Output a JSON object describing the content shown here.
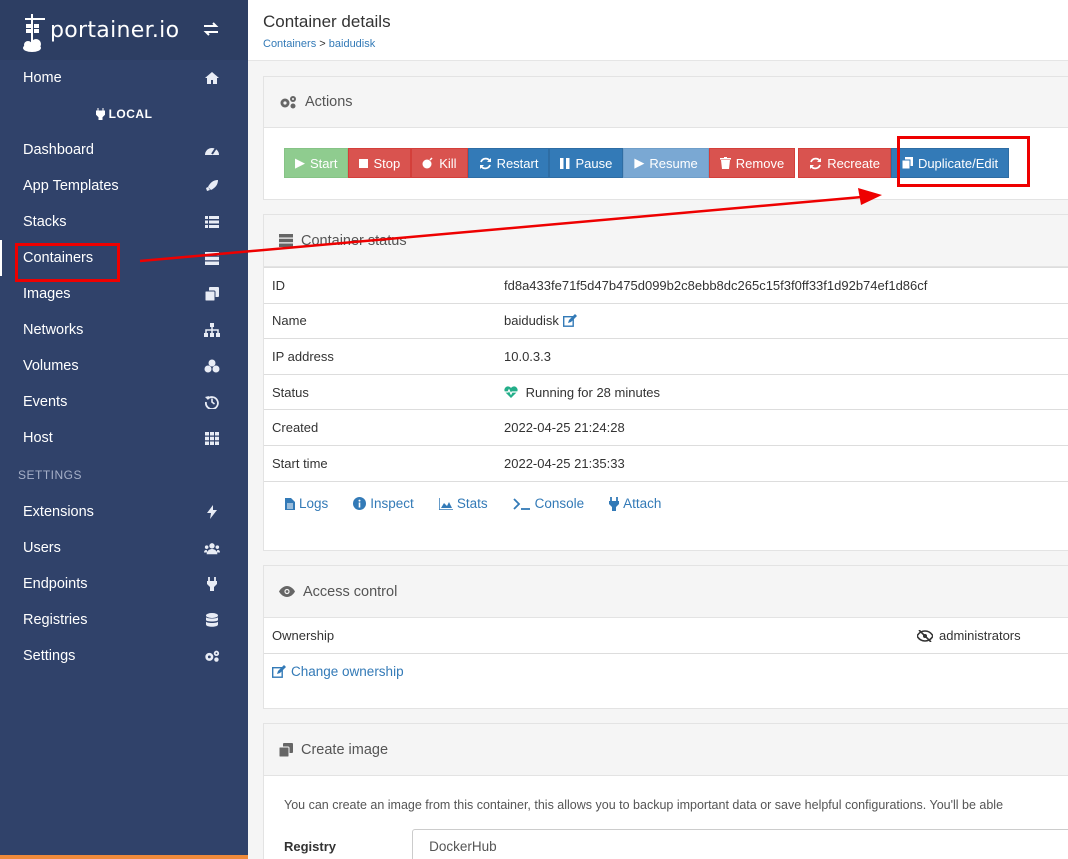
{
  "app": {
    "logo_text": "portainer.io"
  },
  "sidebar": {
    "home": "Home",
    "endpoint": "LOCAL",
    "items": [
      {
        "label": "Dashboard",
        "icon": "tachometer-icon"
      },
      {
        "label": "App Templates",
        "icon": "rocket-icon"
      },
      {
        "label": "Stacks",
        "icon": "list-icon"
      },
      {
        "label": "Containers",
        "icon": "server-icon"
      },
      {
        "label": "Images",
        "icon": "clone-icon"
      },
      {
        "label": "Networks",
        "icon": "sitemap-icon"
      },
      {
        "label": "Volumes",
        "icon": "cubes-icon"
      },
      {
        "label": "Events",
        "icon": "history-icon"
      },
      {
        "label": "Host",
        "icon": "th-icon"
      }
    ],
    "settings_title": "SETTINGS",
    "settings_items": [
      {
        "label": "Extensions",
        "icon": "bolt-icon"
      },
      {
        "label": "Users",
        "icon": "users-icon"
      },
      {
        "label": "Endpoints",
        "icon": "plug-icon"
      },
      {
        "label": "Registries",
        "icon": "database-icon"
      },
      {
        "label": "Settings",
        "icon": "cogs-icon"
      }
    ]
  },
  "header": {
    "title": "Container details",
    "breadcrumb_root": "Containers",
    "breadcrumb_sep": ">",
    "breadcrumb_current": "baidudisk"
  },
  "actions": {
    "title": "Actions",
    "start": "Start",
    "stop": "Stop",
    "kill": "Kill",
    "restart": "Restart",
    "pause": "Pause",
    "resume": "Resume",
    "remove": "Remove",
    "recreate": "Recreate",
    "duplicate": "Duplicate/Edit"
  },
  "status": {
    "title": "Container status",
    "rows": {
      "id_label": "ID",
      "id_value": "fd8a433fe71f5d47b475d099b2c8ebb8dc265c15f3f0ff33f1d92b74ef1d86cf",
      "name_label": "Name",
      "name_value": "baidudisk",
      "ip_label": "IP address",
      "ip_value": "10.0.3.3",
      "status_label": "Status",
      "status_value": "Running for 28 minutes",
      "created_label": "Created",
      "created_value": "2022-04-25 21:24:28",
      "start_label": "Start time",
      "start_value": "2022-04-25 21:35:33"
    },
    "links": {
      "logs": "Logs",
      "inspect": "Inspect",
      "stats": "Stats",
      "console": "Console",
      "attach": "Attach"
    }
  },
  "access": {
    "title": "Access control",
    "ownership_label": "Ownership",
    "ownership_value": "administrators",
    "change": "Change ownership"
  },
  "create_image": {
    "title": "Create image",
    "description": "You can create an image from this container, this allows you to backup important data or save helpful configurations. You'll be able",
    "registry_label": "Registry",
    "registry_value": "DockerHub"
  },
  "colors": {
    "sidebar": "#30426a",
    "primary": "#337ab7",
    "danger": "#d9534f",
    "success_disabled": "#8fcc8f",
    "annotation": "#ee0000"
  }
}
